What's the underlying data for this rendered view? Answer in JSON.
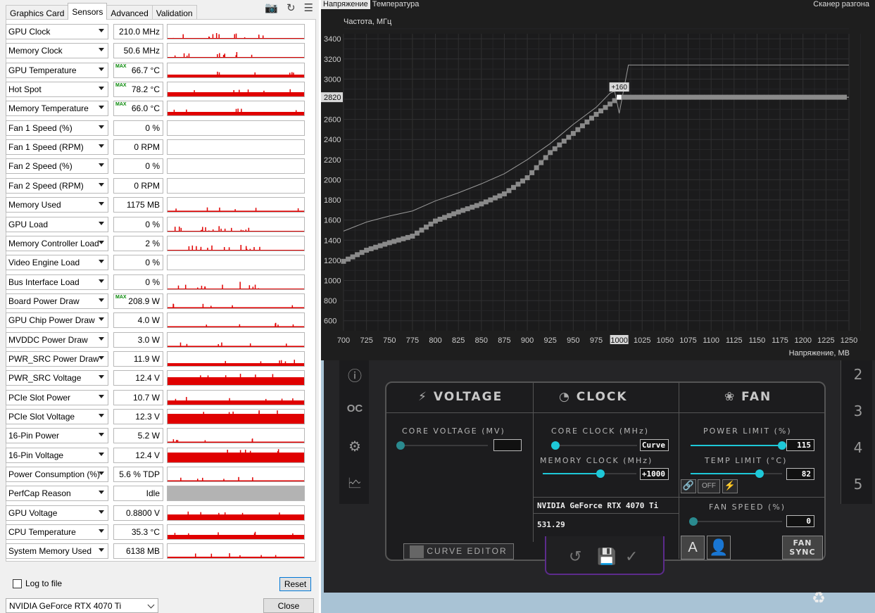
{
  "gpuz": {
    "tabs": [
      "Graphics Card",
      "Sensors",
      "Advanced",
      "Validation"
    ],
    "active_tab": "Sensors",
    "toolbar_icons": [
      "camera-icon",
      "refresh-icon",
      "menu-icon"
    ],
    "max_tag": "MAX",
    "sensors": [
      {
        "name": "GPU Clock",
        "value": "210.0 MHz",
        "max": false,
        "graph": "spikes",
        "fill": 0
      },
      {
        "name": "Memory Clock",
        "value": "50.6 MHz",
        "max": false,
        "graph": "spikes",
        "fill": 0
      },
      {
        "name": "GPU Temperature",
        "value": "66.7 °C",
        "max": true,
        "graph": "bar",
        "fill": 0.2
      },
      {
        "name": "Hot Spot",
        "value": "78.2 °C",
        "max": true,
        "graph": "bar",
        "fill": 0.3
      },
      {
        "name": "Memory Temperature",
        "value": "66.0 °C",
        "max": true,
        "graph": "bar",
        "fill": 0.25
      },
      {
        "name": "Fan 1 Speed (%)",
        "value": "0 %",
        "max": false,
        "graph": "empty",
        "fill": 0
      },
      {
        "name": "Fan 1 Speed (RPM)",
        "value": "0 RPM",
        "max": false,
        "graph": "empty",
        "fill": 0
      },
      {
        "name": "Fan 2 Speed (%)",
        "value": "0 %",
        "max": false,
        "graph": "empty",
        "fill": 0
      },
      {
        "name": "Fan 2 Speed (RPM)",
        "value": "0 RPM",
        "max": false,
        "graph": "empty",
        "fill": 0
      },
      {
        "name": "Memory Used",
        "value": "1175 MB",
        "max": false,
        "graph": "bar",
        "fill": 0.08
      },
      {
        "name": "GPU Load",
        "value": "0 %",
        "max": false,
        "graph": "spikes",
        "fill": 0
      },
      {
        "name": "Memory Controller Load",
        "value": "2 %",
        "max": false,
        "graph": "spikes",
        "fill": 0.04
      },
      {
        "name": "Video Engine Load",
        "value": "0 %",
        "max": false,
        "graph": "empty",
        "fill": 0
      },
      {
        "name": "Bus Interface Load",
        "value": "0 %",
        "max": false,
        "graph": "spikes",
        "fill": 0
      },
      {
        "name": "Board Power Draw",
        "value": "208.9 W",
        "max": true,
        "graph": "bar",
        "fill": 0.06
      },
      {
        "name": "GPU Chip Power Draw",
        "value": "4.0 W",
        "max": false,
        "graph": "bar",
        "fill": 0.02
      },
      {
        "name": "MVDDC Power Draw",
        "value": "3.0 W",
        "max": false,
        "graph": "bar",
        "fill": 0.08
      },
      {
        "name": "PWR_SRC Power Draw",
        "value": "11.9 W",
        "max": false,
        "graph": "bar",
        "fill": 0.2
      },
      {
        "name": "PWR_SRC Voltage",
        "value": "12.4 V",
        "max": false,
        "graph": "bar",
        "fill": 0.55
      },
      {
        "name": "PCIe Slot Power",
        "value": "10.7 W",
        "max": false,
        "graph": "bar",
        "fill": 0.3
      },
      {
        "name": "PCIe Slot Voltage",
        "value": "12.3 V",
        "max": false,
        "graph": "bar",
        "fill": 0.7
      },
      {
        "name": "16-Pin Power",
        "value": "5.2 W",
        "max": false,
        "graph": "bar",
        "fill": 0.04
      },
      {
        "name": "16-Pin Voltage",
        "value": "12.4 V",
        "max": false,
        "graph": "bar",
        "fill": 0.7
      },
      {
        "name": "Power Consumption (%)",
        "value": "5.6 % TDP",
        "max": false,
        "graph": "bar",
        "fill": 0.06
      },
      {
        "name": "PerfCap Reason",
        "value": "Idle",
        "max": false,
        "graph": "gray",
        "fill": 1
      },
      {
        "name": "GPU Voltage",
        "value": "0.8800 V",
        "max": false,
        "graph": "bar",
        "fill": 0.4
      },
      {
        "name": "CPU Temperature",
        "value": "35.3 °C",
        "max": false,
        "graph": "bar",
        "fill": 0.3
      },
      {
        "name": "System Memory Used",
        "value": "6138 MB",
        "max": false,
        "graph": "bar",
        "fill": 0.1
      }
    ],
    "log_to_file_label": "Log to file",
    "reset_label": "Reset",
    "gpu_select_value": "NVIDIA GeForce RTX 4070 Ti",
    "close_label": "Close"
  },
  "curve_editor": {
    "tabs": [
      "Напряжение",
      "Температура"
    ],
    "active_tab": "Напряжение",
    "window_title": "Сканер разгона",
    "chart_data": {
      "type": "line",
      "ylabel": "Частота, МГц",
      "xlabel": "Напряжение, МВ",
      "x_ticks": [
        700,
        725,
        750,
        775,
        800,
        825,
        850,
        875,
        900,
        925,
        950,
        975,
        1000,
        1025,
        1050,
        1075,
        1100,
        1125,
        1150,
        1175,
        1200,
        1225,
        1250
      ],
      "y_ticks": [
        600,
        800,
        1000,
        1200,
        1400,
        1600,
        1800,
        2000,
        2200,
        2400,
        2600,
        2800,
        3000,
        3200,
        3400
      ],
      "xlim": [
        700,
        1250
      ],
      "ylim": [
        500,
        3450
      ],
      "highlight_x": "1000",
      "highlight_y": "2820",
      "offset_label": "+160",
      "series": [
        {
          "role": "reference",
          "color": "#9a9a9a",
          "x": [
            700,
            725,
            750,
            775,
            800,
            825,
            850,
            875,
            900,
            925,
            950,
            975,
            990,
            995,
            1000,
            1010,
            1250
          ],
          "y": [
            1490,
            1580,
            1640,
            1690,
            1790,
            1870,
            1960,
            2060,
            2200,
            2360,
            2550,
            2720,
            2860,
            2880,
            2660,
            3140,
            3140
          ]
        },
        {
          "role": "curve",
          "color": "#b8b8b8",
          "x": [
            700,
            725,
            750,
            775,
            800,
            825,
            850,
            875,
            900,
            925,
            950,
            975,
            1000,
            1250
          ],
          "y": [
            1190,
            1300,
            1375,
            1440,
            1590,
            1680,
            1760,
            1860,
            2020,
            2270,
            2460,
            2650,
            2820,
            2820
          ]
        }
      ]
    }
  },
  "afterburner": {
    "left_icons": [
      "info-icon",
      "oc-scanner-icon",
      "settings-icon",
      "monitor-icon"
    ],
    "profiles": [
      "2",
      "3",
      "4",
      "5"
    ],
    "voltage": {
      "title": "VOLTAGE",
      "core_voltage_label": "CORE VOLTAGE (MV)",
      "core_voltage_value": "",
      "curve_editor_label": "CURVE EDITOR"
    },
    "clock": {
      "title": "CLOCK",
      "core_clock_label": "CORE CLOCK (MHz)",
      "core_clock_value": "Curve",
      "memory_clock_label": "MEMORY CLOCK (MHz)",
      "memory_clock_value": "+1000",
      "gpu_name": "NVIDIA GeForce RTX 4070 Ti",
      "driver_version": "531.29"
    },
    "fan": {
      "title": "FAN",
      "power_limit_label": "POWER LIMIT (%)",
      "power_limit_value": "115",
      "temp_limit_label": "TEMP LIMIT (°C)",
      "temp_limit_value": "82",
      "off_label": "OFF",
      "fan_speed_label": "FAN SPEED (%)",
      "fan_speed_value": "0",
      "auto_label": "A",
      "fan_sync_label": "FAN SYNC"
    },
    "bottom_icons": [
      "reset-icon",
      "save-icon",
      "apply-icon"
    ]
  }
}
